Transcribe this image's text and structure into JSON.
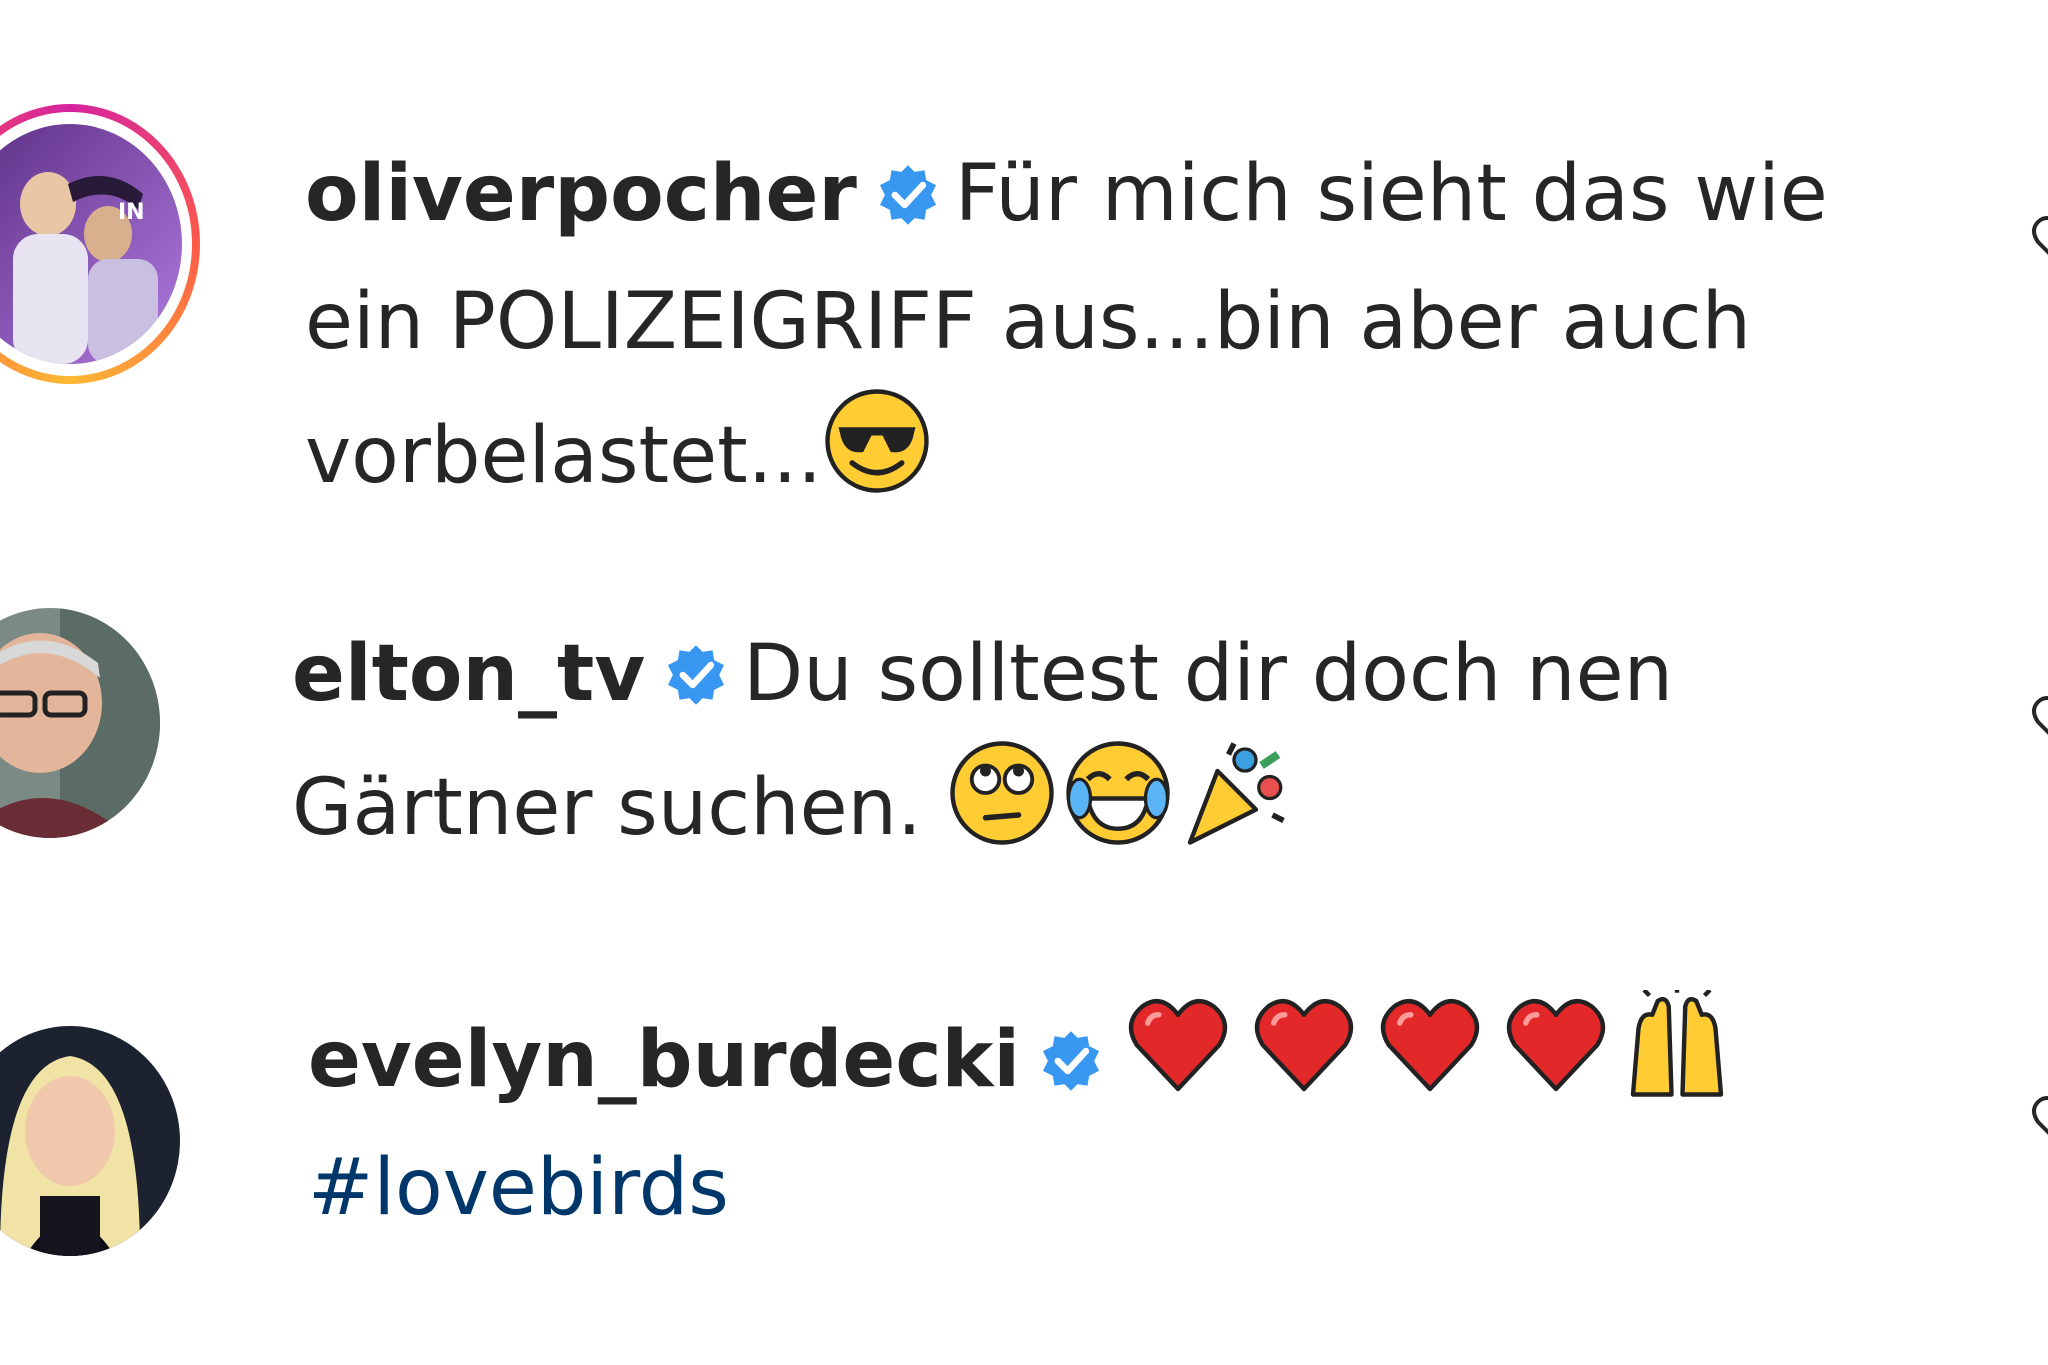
{
  "comments": [
    {
      "username": "oliverpocher",
      "verified": true,
      "text": "Für mich sieht das wie ein POLIZEIGRIFF aus...bin aber auch vorbelastet...",
      "emojis": [
        "smiling-face-with-sunglasses"
      ],
      "story_ring": true
    },
    {
      "username": "elton_tv",
      "verified": true,
      "text": "Du solltest dir doch nen Gärtner suchen.",
      "emojis": [
        "face-with-rolling-eyes",
        "face-with-tears-of-joy",
        "party-popper"
      ],
      "story_ring": false
    },
    {
      "username": "evelyn_burdecki",
      "verified": true,
      "text": "",
      "emojis": [
        "red-heart",
        "red-heart",
        "red-heart",
        "red-heart",
        "raising-hands"
      ],
      "hashtag": "#lovebirds",
      "story_ring": false
    }
  ],
  "colors": {
    "verified_badge": "#3897f0",
    "hashtag": "#00376b",
    "text": "#262626"
  }
}
